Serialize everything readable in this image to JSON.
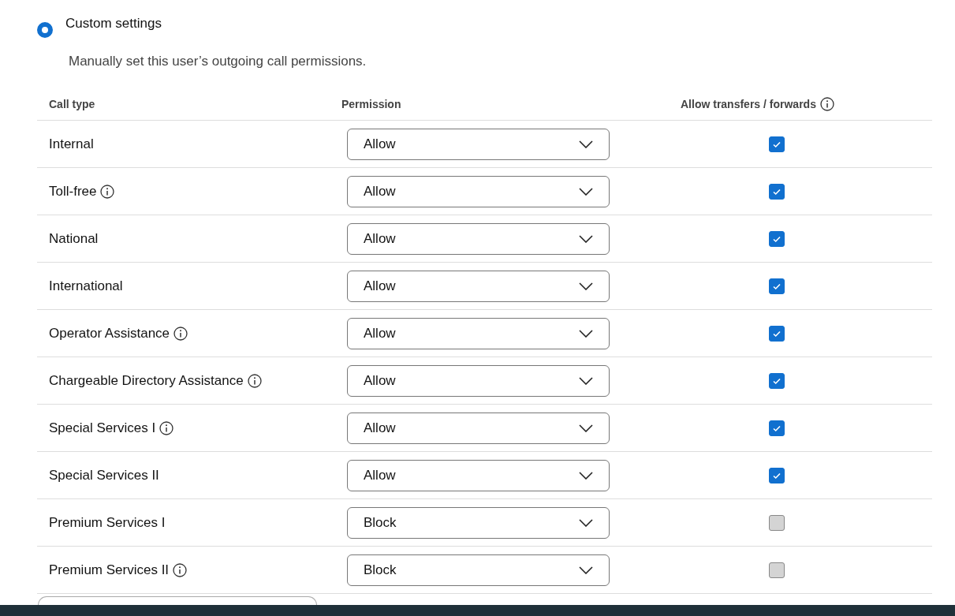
{
  "option": {
    "label": "Custom settings",
    "selected": true,
    "description": "Manually set this user’s outgoing call permissions."
  },
  "table": {
    "columns": [
      "Call type",
      "Permission",
      "Allow transfers / forwards"
    ],
    "rows": [
      {
        "call_type": "Internal",
        "info": false,
        "permission": "Allow",
        "checked": true
      },
      {
        "call_type": "Toll-free",
        "info": true,
        "permission": "Allow",
        "checked": true
      },
      {
        "call_type": "National",
        "info": false,
        "permission": "Allow",
        "checked": true
      },
      {
        "call_type": "International",
        "info": false,
        "permission": "Allow",
        "checked": true
      },
      {
        "call_type": "Operator Assistance",
        "info": true,
        "permission": "Allow",
        "checked": true
      },
      {
        "call_type": "Chargeable Directory Assistance",
        "info": true,
        "permission": "Allow",
        "checked": true
      },
      {
        "call_type": "Special Services I",
        "info": true,
        "permission": "Allow",
        "checked": true
      },
      {
        "call_type": "Special Services II",
        "info": false,
        "permission": "Allow",
        "checked": true
      },
      {
        "call_type": "Premium Services I",
        "info": false,
        "permission": "Block",
        "checked": false
      },
      {
        "call_type": "Premium Services II",
        "info": true,
        "permission": "Block",
        "checked": false
      }
    ]
  }
}
